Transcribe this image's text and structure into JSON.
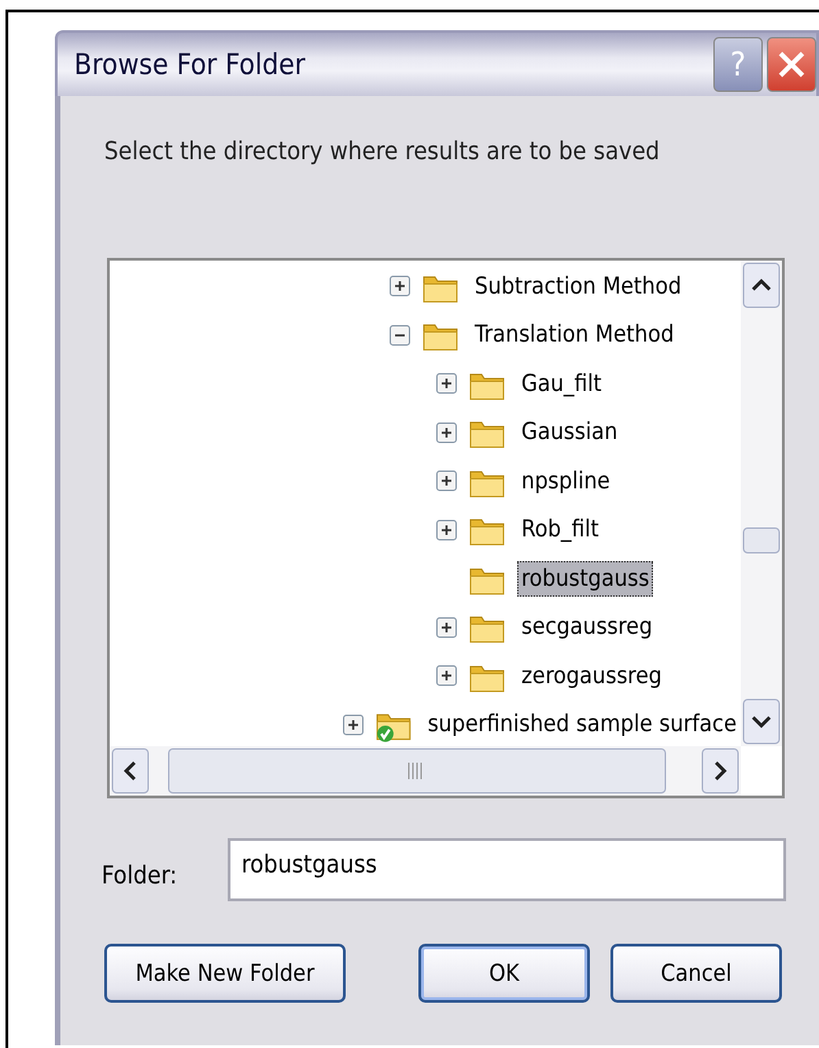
{
  "window": {
    "title": "Browse For Folder",
    "help_button": "?"
  },
  "prompt": "Select the directory where results are to be saved",
  "tree": {
    "items": [
      {
        "children": [
          {
            "label": "Subtraction Method",
            "kind": "folder",
            "expanded": false,
            "selected": false
          },
          {
            "label": "Translation Method",
            "kind": "folder",
            "expanded": true,
            "selected": false,
            "children": [
              {
                "label": "Gau_filt",
                "kind": "folder",
                "expanded": false,
                "selected": false
              },
              {
                "label": "Gaussian",
                "kind": "folder",
                "expanded": false,
                "selected": false
              },
              {
                "label": "npspline",
                "kind": "folder",
                "expanded": false,
                "selected": false
              },
              {
                "label": "Rob_filt",
                "kind": "folder",
                "expanded": false,
                "selected": false
              },
              {
                "label": "robustgauss",
                "kind": "folder",
                "selected": true
              },
              {
                "label": "secgaussreg",
                "kind": "folder",
                "expanded": false,
                "selected": false
              },
              {
                "label": "zerogaussreg",
                "kind": "folder",
                "expanded": false,
                "selected": false
              }
            ]
          }
        ]
      },
      {
        "label": "superfinished sample surface",
        "kind": "checked-folder",
        "expanded": false,
        "selected": false
      }
    ]
  },
  "folder_field": {
    "label": "Folder:",
    "value": "robustgauss"
  },
  "buttons": [
    {
      "label": "Make New Folder",
      "default": false
    },
    {
      "label": "OK",
      "default": true
    },
    {
      "label": "Cancel",
      "default": false
    }
  ]
}
